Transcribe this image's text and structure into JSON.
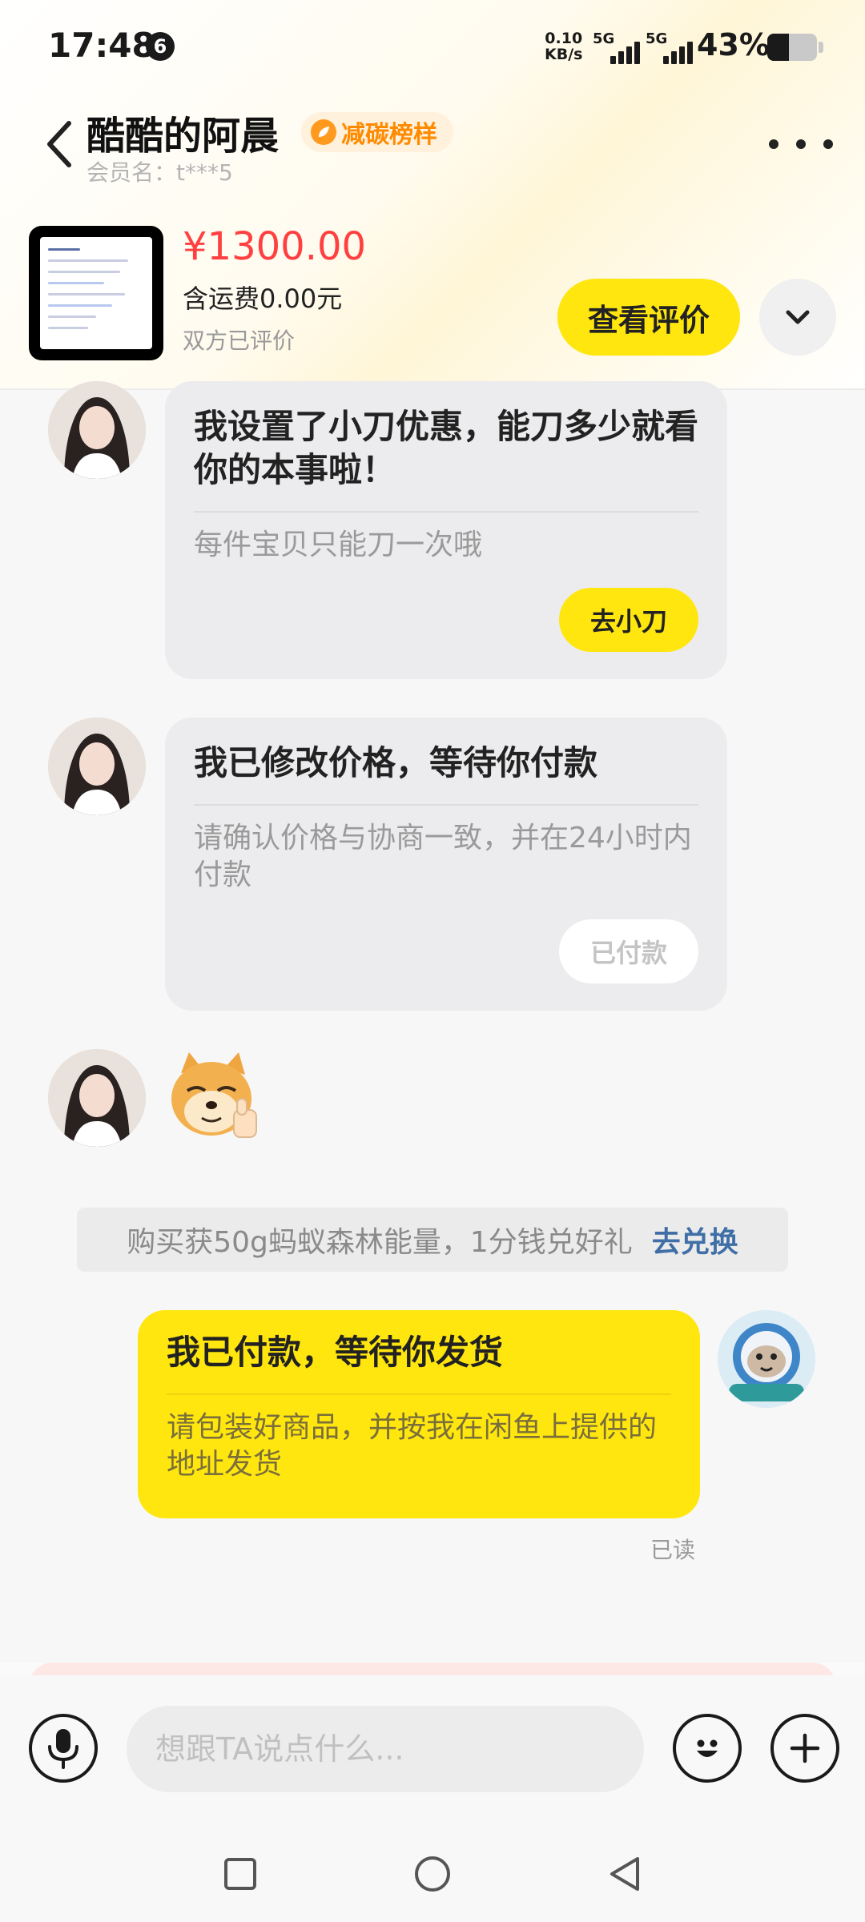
{
  "status_bar": {
    "time": "17:48",
    "notification_count": "6",
    "net_speed_value": "0.10",
    "net_speed_unit": "KB/s",
    "signal_1_label": "5G",
    "signal_2_label": "5G",
    "battery_percent": "43%",
    "battery_level": 0.43
  },
  "header": {
    "seller_name": "酷酷的阿晨",
    "badge_label": "减碳榜样",
    "member_name": "会员名：t***5"
  },
  "product": {
    "price": "¥1300.00",
    "shipping": "含运费0.00元",
    "review_status": "双方已评价",
    "review_button": "查看评价"
  },
  "messages": {
    "m1_title": "我设置了小刀优惠，能刀多少就看你的本事啦！",
    "m1_sub": "每件宝贝只能刀一次哦",
    "m1_action": "去小刀",
    "m2_title": "我已修改价格，等待你付款",
    "m2_sub": "请确认价格与协商一致，并在24小时内付款",
    "m2_action": "已付款",
    "promo_text": "购买获50g蚂蚁森林能量，1分钱兑好礼",
    "promo_link": "去兑换",
    "m4_title": "我已付款，等待你发货",
    "m4_sub": "请包装好商品，并按我在闲鱼上提供的地址发货",
    "m4_read": "已读"
  },
  "input": {
    "placeholder": "想跟TA说点什么..."
  },
  "colors": {
    "accent_yellow": "#ffe60f",
    "price_red": "#ff4040",
    "link_blue": "#3f6fa6"
  }
}
